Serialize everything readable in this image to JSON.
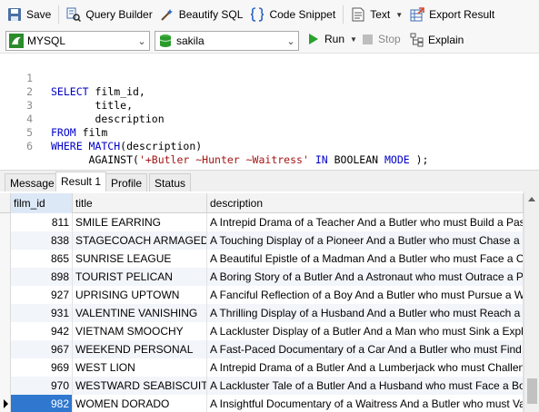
{
  "toolbar": {
    "save": "Save",
    "query_builder": "Query Builder",
    "beautify_sql": "Beautify SQL",
    "code_snippet": "Code Snippet",
    "text": "Text",
    "export_result": "Export Result"
  },
  "connection": {
    "name": "MYSQL"
  },
  "database": {
    "name": "sakila"
  },
  "actions": {
    "run": "Run",
    "stop": "Stop",
    "explain": "Explain"
  },
  "editor": {
    "line_numbers": [
      "1",
      "2",
      "3",
      "4",
      "5",
      "6"
    ]
  },
  "tabs": [
    "Message",
    "Result 1",
    "Profile",
    "Status"
  ],
  "active_tab": "Result 1",
  "grid": {
    "columns": [
      "film_id",
      "title",
      "description"
    ],
    "rows": [
      {
        "film_id": "811",
        "title": "SMILE EARRING",
        "description": "A Intrepid Drama of a Teacher And a Butler who must Build a Pastry"
      },
      {
        "film_id": "838",
        "title": "STAGECOACH ARMAGEDDON",
        "description": "A Touching Display of a Pioneer And a Butler who must Chase a Car"
      },
      {
        "film_id": "865",
        "title": "SUNRISE LEAGUE",
        "description": "A Beautiful Epistle of a Madman And a Butler who must Face a Crocodile"
      },
      {
        "film_id": "898",
        "title": "TOURIST PELICAN",
        "description": "A Boring Story of a Butler And a Astronaut who must Outrace a Pioneer"
      },
      {
        "film_id": "927",
        "title": "UPRISING UPTOWN",
        "description": "A Fanciful Reflection of a Boy And a Butler who must Pursue a Woman"
      },
      {
        "film_id": "931",
        "title": "VALENTINE VANISHING",
        "description": "A Thrilling Display of a Husband And a Butler who must Reach a Pastry"
      },
      {
        "film_id": "942",
        "title": "VIETNAM SMOOCHY",
        "description": "A Lackluster Display of a Butler And a Man who must Sink a Explorer"
      },
      {
        "film_id": "967",
        "title": "WEEKEND PERSONAL",
        "description": "A Fast-Paced Documentary of a Car And a Butler who must Find a Frisbee"
      },
      {
        "film_id": "969",
        "title": "WEST LION",
        "description": "A Intrepid Drama of a Butler And a Lumberjack who must Challenge a Database Administrator"
      },
      {
        "film_id": "970",
        "title": "WESTWARD SEABISCUIT",
        "description": "A Lackluster Tale of a Butler And a Husband who must Face a Boy"
      },
      {
        "film_id": "982",
        "title": "WOMEN DORADO",
        "description": "A Insightful Documentary of a Waitress And a Butler who must Vanquish a Composer"
      }
    ],
    "selected_row": 10
  },
  "colors": {
    "keyword": "#0000c8",
    "string": "#a31515",
    "selection": "#2f77cf",
    "run_green": "#2aa12a"
  }
}
